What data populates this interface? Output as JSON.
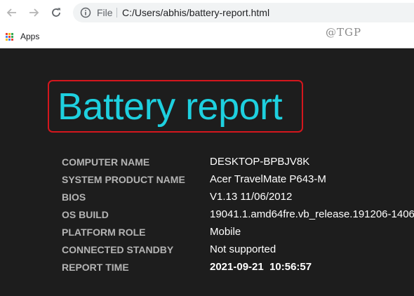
{
  "browser": {
    "scheme_label": "File",
    "url": "C:/Users/abhis/battery-report.html",
    "bookmarks": [
      {
        "label": "Apps"
      }
    ],
    "apps_colors": [
      "#ea4335",
      "#fbbc05",
      "#34a853",
      "#4285f4",
      "#ea4335",
      "#34a853",
      "#fbbc05",
      "#4285f4",
      "#ea4335"
    ],
    "icons": [
      "back-arrow-icon",
      "forward-arrow-icon",
      "reload-icon",
      "info-icon",
      "apps-grid-icon"
    ]
  },
  "watermark": "@TGP",
  "report": {
    "title": "Battery report",
    "title_color": "#1ed0df",
    "highlight_color": "#d4161d",
    "rows": [
      {
        "key": "COMPUTER NAME",
        "value": "DESKTOP-BPBJV8K"
      },
      {
        "key": "SYSTEM PRODUCT NAME",
        "value": "Acer TravelMate P643-M"
      },
      {
        "key": "BIOS",
        "value": "V1.13 11/06/2012"
      },
      {
        "key": "OS BUILD",
        "value": "19041.1.amd64fre.vb_release.191206-1406"
      },
      {
        "key": "PLATFORM ROLE",
        "value": "Mobile"
      },
      {
        "key": "CONNECTED STANDBY",
        "value": "Not supported"
      },
      {
        "key": "REPORT TIME",
        "value": "2021-09-21  10:56:57"
      }
    ]
  }
}
